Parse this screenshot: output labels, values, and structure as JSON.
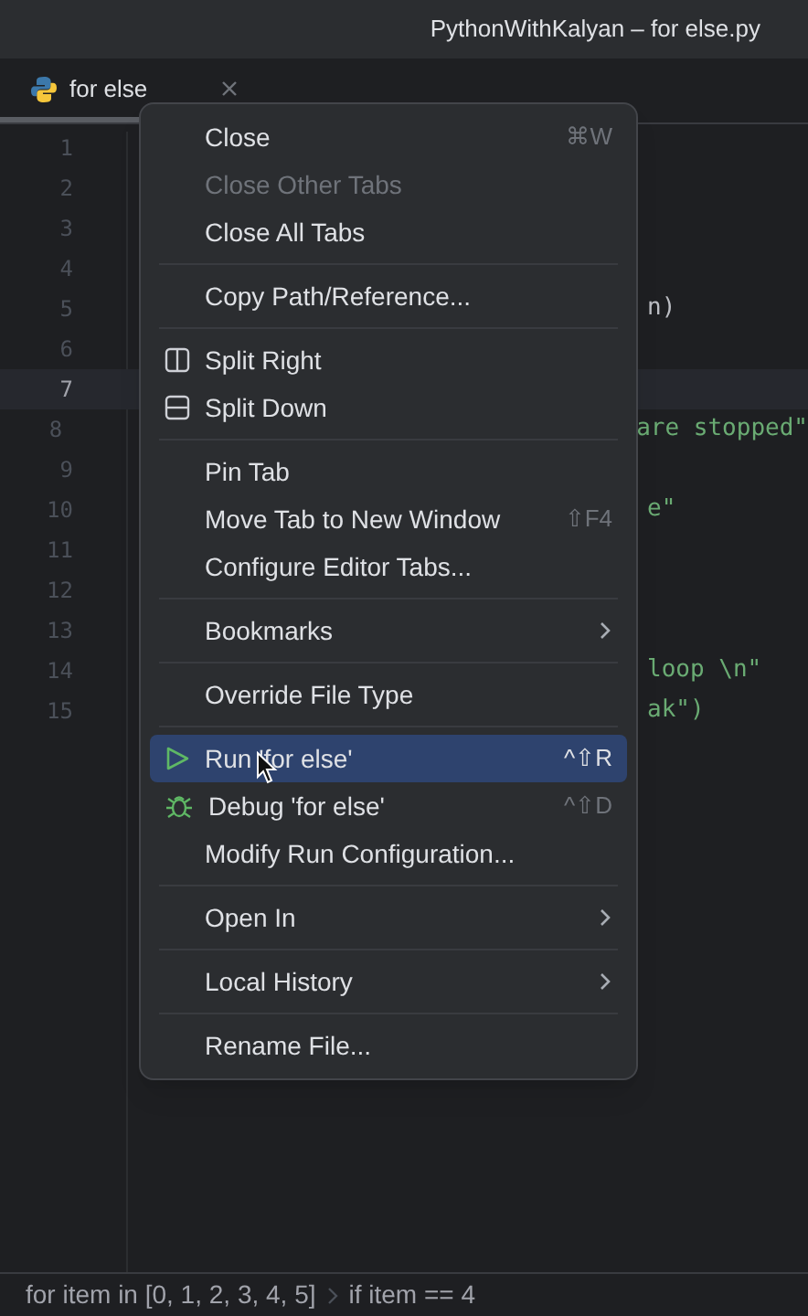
{
  "window": {
    "title": "PythonWithKalyan – for else.py"
  },
  "tabs": [
    {
      "label": "for else",
      "selected": true
    }
  ],
  "editor": {
    "lines": [
      {
        "number": "1",
        "current": false
      },
      {
        "number": "2",
        "current": false
      },
      {
        "number": "3",
        "current": false
      },
      {
        "number": "4",
        "current": false
      },
      {
        "number": "5",
        "current": false,
        "text": "n)",
        "kind": "plain"
      },
      {
        "number": "6",
        "current": false
      },
      {
        "number": "7",
        "current": true
      },
      {
        "number": "8",
        "current": false,
        "text": "are stopped\"",
        "kind": "string"
      },
      {
        "number": "9",
        "current": false
      },
      {
        "number": "10",
        "current": false,
        "text": "e\"",
        "kind": "string"
      },
      {
        "number": "11",
        "current": false
      },
      {
        "number": "12",
        "current": false
      },
      {
        "number": "13",
        "current": false
      },
      {
        "number": "14",
        "current": false,
        "text": "loop \\n\"",
        "kind": "string"
      },
      {
        "number": "15",
        "current": false,
        "text": "ak\")",
        "kind": "string"
      }
    ]
  },
  "menu": {
    "groups": [
      [
        {
          "label": "Close",
          "shortcut": "⌘W",
          "kind": "plain",
          "disabled": false,
          "selected": false
        },
        {
          "label": "Close Other Tabs",
          "kind": "plain",
          "disabled": true,
          "selected": false
        },
        {
          "label": "Close All Tabs",
          "kind": "plain",
          "disabled": false,
          "selected": false
        }
      ],
      [
        {
          "label": "Copy Path/Reference...",
          "kind": "plain",
          "disabled": false,
          "selected": false
        }
      ],
      [
        {
          "label": "Split Right",
          "kind": "split-right",
          "disabled": false,
          "selected": false
        },
        {
          "label": "Split Down",
          "kind": "split-down",
          "disabled": false,
          "selected": false
        }
      ],
      [
        {
          "label": "Pin Tab",
          "kind": "plain",
          "disabled": false,
          "selected": false
        },
        {
          "label": "Move Tab to New Window",
          "shortcut": "⇧F4",
          "kind": "plain",
          "disabled": false,
          "selected": false
        },
        {
          "label": "Configure Editor Tabs...",
          "kind": "plain",
          "disabled": false,
          "selected": false
        }
      ],
      [
        {
          "label": "Bookmarks",
          "kind": "submenu",
          "disabled": false,
          "selected": false
        }
      ],
      [
        {
          "label": "Override File Type",
          "kind": "plain",
          "disabled": false,
          "selected": false
        }
      ],
      [
        {
          "label": "Run 'for else'",
          "shortcut": "^⇧R",
          "kind": "run",
          "disabled": false,
          "selected": true
        },
        {
          "label": "Debug 'for else'",
          "shortcut": "^⇧D",
          "kind": "debug",
          "disabled": false,
          "selected": false
        },
        {
          "label": "Modify Run Configuration...",
          "kind": "plain",
          "disabled": false,
          "selected": false
        }
      ],
      [
        {
          "label": "Open In",
          "kind": "submenu",
          "disabled": false,
          "selected": false
        }
      ],
      [
        {
          "label": "Local History",
          "kind": "submenu",
          "disabled": false,
          "selected": false
        }
      ],
      [
        {
          "label": "Rename File...",
          "kind": "plain",
          "disabled": false,
          "selected": false
        }
      ]
    ]
  },
  "breadcrumbs": [
    {
      "label": "for item in [0, 1, 2, 3, 4, 5]"
    },
    {
      "label": "if item == 4"
    }
  ]
}
